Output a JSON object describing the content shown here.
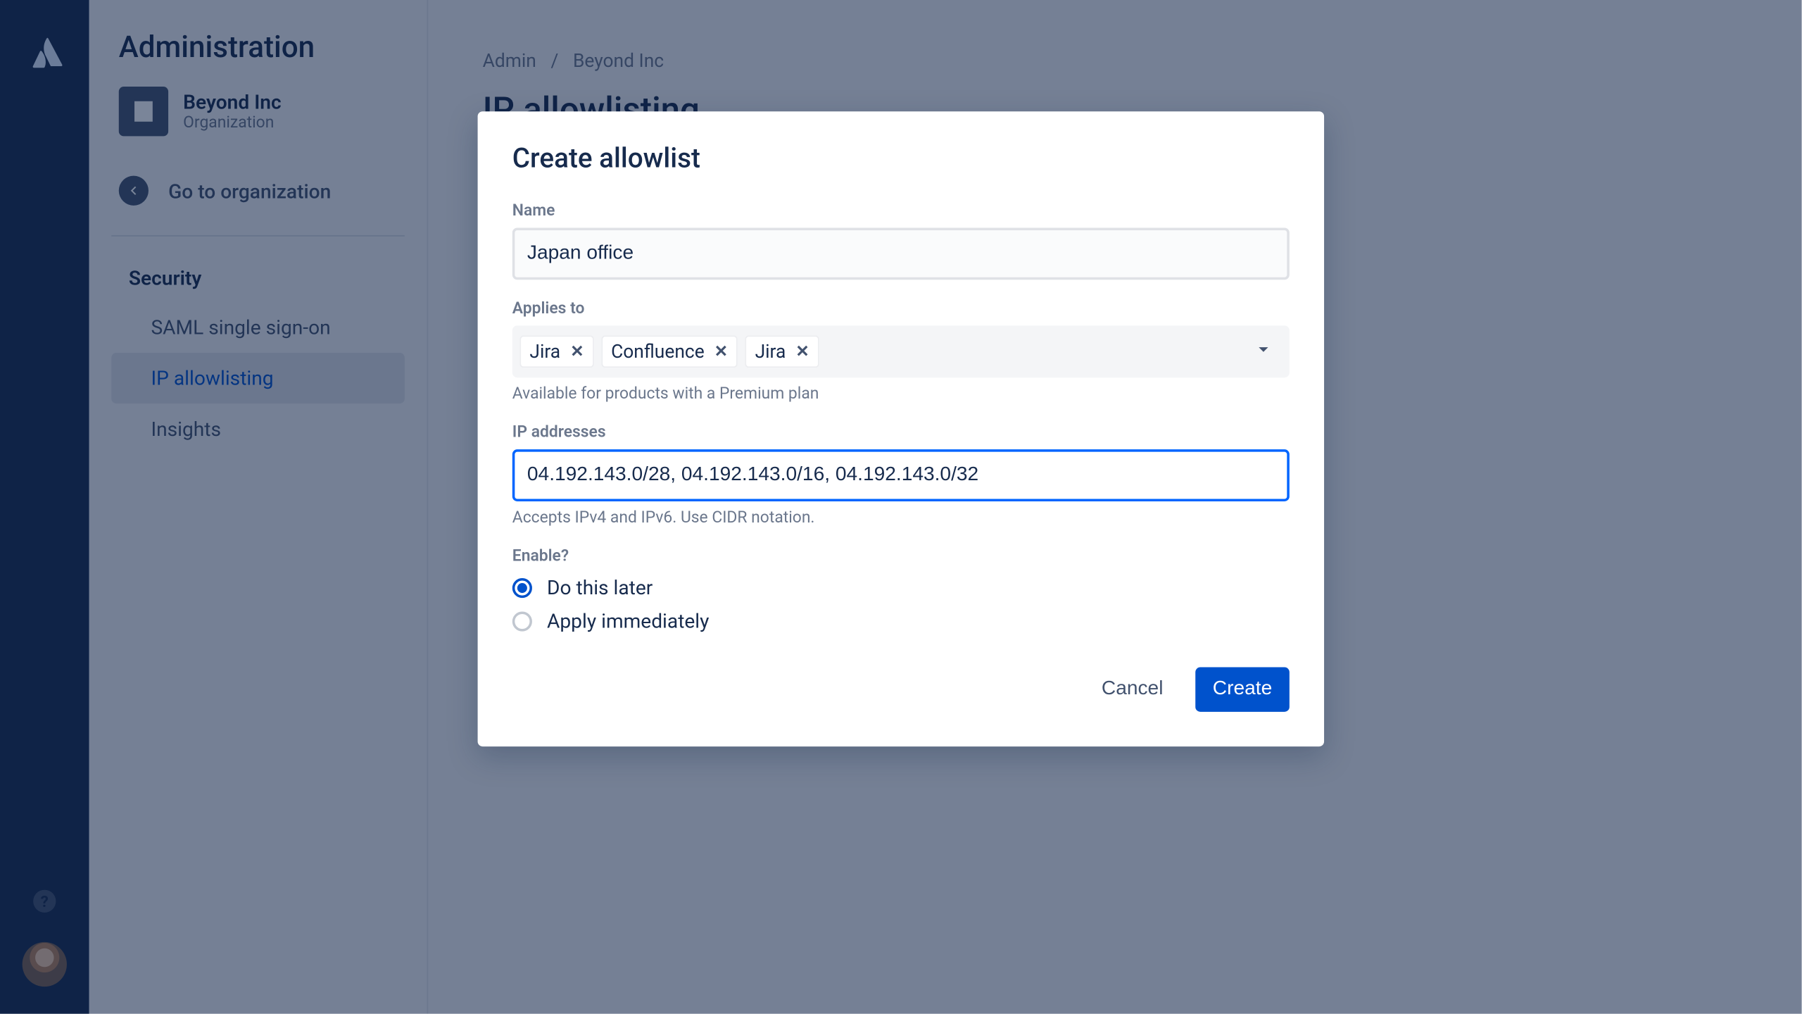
{
  "sidebar": {
    "title": "Administration",
    "org_name": "Beyond Inc",
    "org_sub": "Organization",
    "goto_label": "Go to organization",
    "section_head": "Security",
    "items": [
      {
        "label": "SAML single sign-on"
      },
      {
        "label": "IP allowlisting"
      },
      {
        "label": "Insights"
      }
    ]
  },
  "breadcrumb": {
    "part1": "Admin",
    "sep": "/",
    "part2": "Beyond Inc"
  },
  "page": {
    "title": "IP allowlisting"
  },
  "dialog": {
    "title": "Create allowlist",
    "name_label": "Name",
    "name_value": "Japan office",
    "applies_label": "Applies to",
    "tags": [
      "Jira",
      "Confluence",
      "Jira"
    ],
    "applies_help": "Available for products with a Premium plan",
    "ip_label": "IP addresses",
    "ip_value": "04.192.143.0/28, 04.192.143.0/16, 04.192.143.0/32",
    "ip_help": "Accepts IPv4 and IPv6. Use CIDR notation.",
    "enable_label": "Enable?",
    "radio_later": "Do this later",
    "radio_now": "Apply immediately",
    "cancel": "Cancel",
    "create": "Create"
  }
}
